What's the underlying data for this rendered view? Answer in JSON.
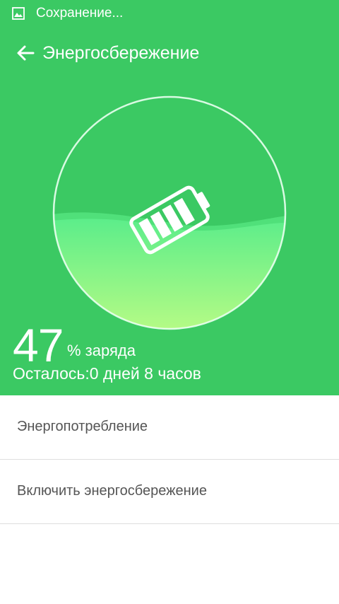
{
  "status_bar": {
    "icon": "image-icon",
    "text": "Сохранение..."
  },
  "app_bar": {
    "back_icon": "arrow-left-icon",
    "title": "Энергосбережение"
  },
  "battery": {
    "icon": "battery-icon",
    "charge_value": "47",
    "charge_unit": "% заряда",
    "charge_level": 0.47,
    "remaining": "Осталось:0 дней 8 часов"
  },
  "menu": {
    "items": [
      {
        "label": "Энергопотребление"
      },
      {
        "label": "Включить энергосбережение"
      }
    ]
  },
  "colors": {
    "accent": "#3bc963",
    "liquid_top": "#5ced8a",
    "liquid_bottom": "#b5fb85",
    "list_text": "#555555",
    "divider": "#dedede"
  }
}
